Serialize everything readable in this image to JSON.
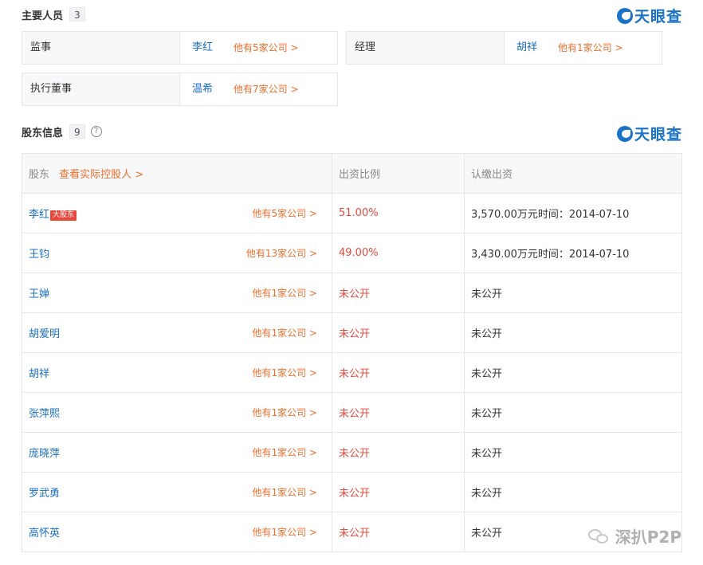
{
  "brand": {
    "name": "天眼查"
  },
  "key_personnel": {
    "title": "主要人员",
    "count": "3",
    "people": [
      {
        "role": "监事",
        "name": "李红",
        "link": "他有5家公司 >"
      },
      {
        "role": "经理",
        "name": "胡祥",
        "link": "他有1家公司 >"
      },
      {
        "role": "执行董事",
        "name": "温希",
        "link": "他有7家公司 >"
      }
    ]
  },
  "shareholders": {
    "title": "股东信息",
    "count": "9",
    "help_icon": "?",
    "columns": {
      "holder": "股东",
      "holder_link": "查看实际控股人 >",
      "ratio": "出资比例",
      "capital": "认缴出资"
    },
    "major_tag": "大股东",
    "rows": [
      {
        "name": "李红",
        "major": true,
        "link": "他有5家公司 >",
        "ratio": "51.00%",
        "capital": "3,570.00万元时间：2014-07-10"
      },
      {
        "name": "王钧",
        "major": false,
        "link": "他有13家公司 >",
        "ratio": "49.00%",
        "capital": "3,430.00万元时间：2014-07-10"
      },
      {
        "name": "王婵",
        "major": false,
        "link": "他有1家公司 >",
        "ratio": "未公开",
        "capital": "未公开"
      },
      {
        "name": "胡爱明",
        "major": false,
        "link": "他有1家公司 >",
        "ratio": "未公开",
        "capital": "未公开"
      },
      {
        "name": "胡祥",
        "major": false,
        "link": "他有1家公司 >",
        "ratio": "未公开",
        "capital": "未公开"
      },
      {
        "name": "张萍熙",
        "major": false,
        "link": "他有1家公司 >",
        "ratio": "未公开",
        "capital": "未公开"
      },
      {
        "name": "庞晓萍",
        "major": false,
        "link": "他有1家公司 >",
        "ratio": "未公开",
        "capital": "未公开"
      },
      {
        "name": "罗武勇",
        "major": false,
        "link": "他有1家公司 >",
        "ratio": "未公开",
        "capital": "未公开"
      },
      {
        "name": "高怀英",
        "major": false,
        "link": "他有1家公司 >",
        "ratio": "未公开",
        "capital": "未公开"
      }
    ]
  },
  "watermark": {
    "text": "深扒P2P",
    "icon": "wechat-icon"
  },
  "colors": {
    "link_blue": "#1a6fc4",
    "accent_orange": "#f06e2b",
    "ratio_red": "#e8483b",
    "brand_blue": "#1a73c8"
  }
}
